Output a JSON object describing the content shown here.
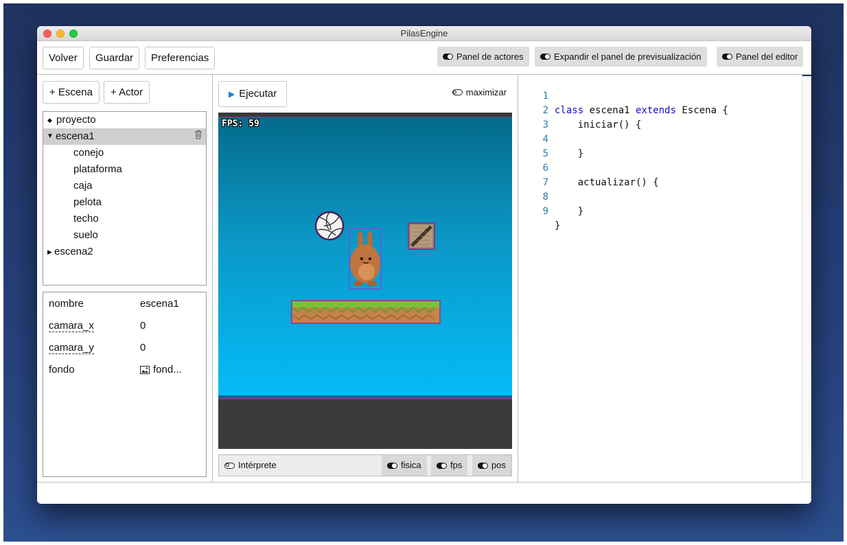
{
  "window": {
    "title": "PilasEngine"
  },
  "toolbar": {
    "back_label": "Volver",
    "save_label": "Guardar",
    "prefs_label": "Preferencias",
    "toggle_actors_label": "Panel de actores",
    "toggle_preview_label": "Expandir el panel de previsualización",
    "toggle_editor_label": "Panel del editor"
  },
  "left": {
    "add_scene_label": "+ Escena",
    "add_actor_label": "+ Actor",
    "tree": {
      "project": "proyecto",
      "scene1": "escena1",
      "actors": [
        "conejo",
        "plataforma",
        "caja",
        "pelota",
        "techo",
        "suelo"
      ],
      "scene2": "escena2"
    },
    "props": [
      {
        "key": "nombre",
        "value": "escena1"
      },
      {
        "key": "camara_x",
        "value": "0"
      },
      {
        "key": "camara_y",
        "value": "0"
      },
      {
        "key": "fondo",
        "value": "fond..."
      }
    ]
  },
  "center": {
    "run_label": "Ejecutar",
    "maximize_label": "maximizar",
    "fps_text": "FPS: 59",
    "interpreter_label": "Intérprete",
    "toggles": [
      "fisica",
      "fps",
      "pos"
    ]
  },
  "editor": {
    "line_numbers": [
      "1",
      "2",
      "3",
      "4",
      "5",
      "6",
      "7",
      "8",
      "9"
    ],
    "lines": {
      "l1_kw1": "class",
      "l1_name": " escena1 ",
      "l1_kw2": "extends",
      "l1_rest": " Escena {",
      "l2": "    iniciar() {",
      "l3": "",
      "l4": "    }",
      "l5": "",
      "l6": "    actualizar() {",
      "l7": "",
      "l8": "    }",
      "l9": "}"
    }
  },
  "colors": {
    "accent_play": "#1e7fd9",
    "keyword": "#1010c8",
    "line_number": "#2a7fa8",
    "tree_selected": "#cfcfcf"
  }
}
